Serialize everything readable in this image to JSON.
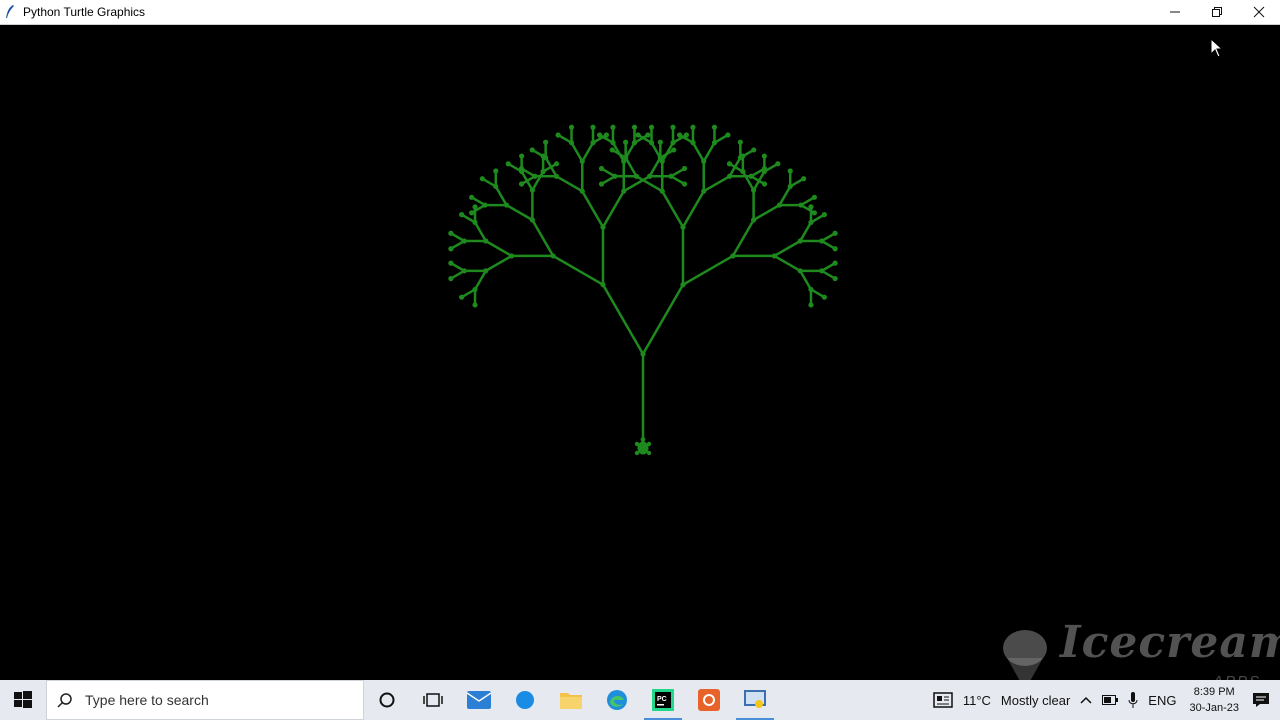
{
  "window": {
    "title": "Python Turtle Graphics",
    "controls": [
      "minimize",
      "restore",
      "close"
    ]
  },
  "canvas": {
    "background": "#000000",
    "pen_color": "#1e8a1e",
    "drawing": "fractal-tree",
    "turtle_shape": "turtle"
  },
  "watermark": {
    "brand": "Icecream",
    "sub": "APPS"
  },
  "taskbar": {
    "search_placeholder": "Type here to search",
    "apps": [
      "cortana-icon",
      "task-view-icon",
      "mail-icon",
      "browser-icon",
      "file-explorer-icon",
      "edge-icon",
      "pycharm-icon",
      "app-icon",
      "python-idle-icon"
    ],
    "weather_temp": "11°C",
    "weather_text": "Mostly clear",
    "language": "ENG",
    "time": "8:39 PM",
    "date": "30-Jan-23"
  }
}
